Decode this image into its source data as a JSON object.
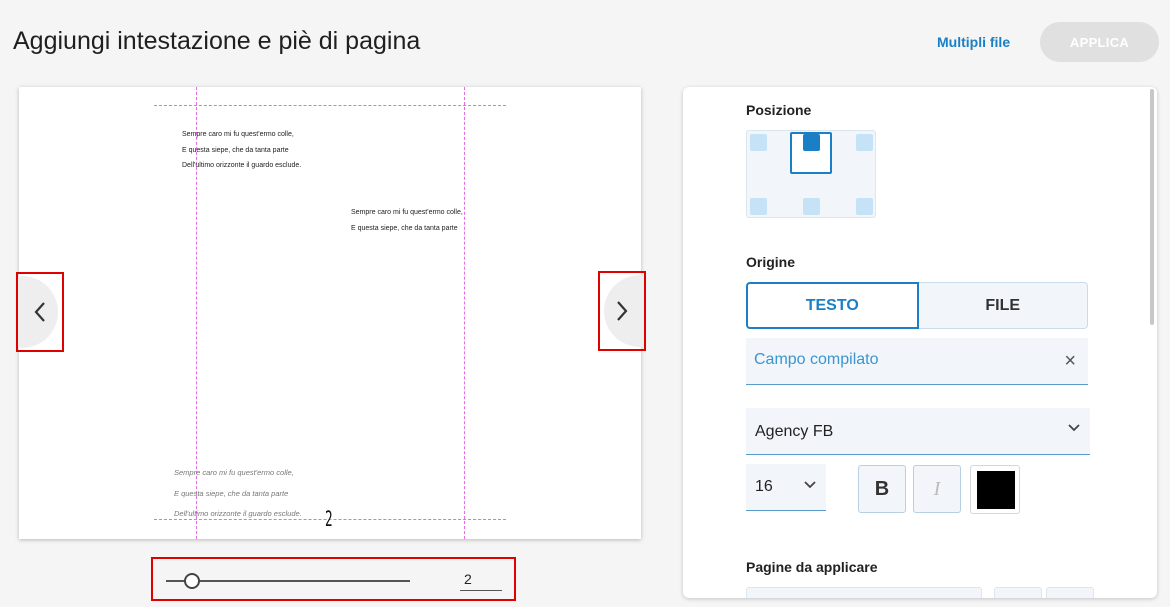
{
  "header": {
    "title": "Aggiungi intestazione e piè di pagina",
    "multi_files_label": "Multipli file",
    "apply_label": "APPLICA"
  },
  "preview": {
    "top_lines": [
      "Sempre caro mi fu quest'ermo colle,",
      "E questa siepe, che da tanta parte",
      "Dell'ultimo orizzonte il guardo esclude."
    ],
    "middle_lines": [
      "Sempre caro mi fu quest'ermo colle,",
      "E questa siepe, che da tanta parte"
    ],
    "footer_lines": [
      "Sempre caro mi fu quest'ermo colle,",
      "E questa siepe, che da tanta parte",
      "Dell'ultimo orizzonte il guardo esclude."
    ],
    "page_number": "2"
  },
  "slider": {
    "value": "2"
  },
  "panel": {
    "position_label": "Posizione",
    "origin_label": "Origine",
    "text_tab": "TESTO",
    "file_tab": "FILE",
    "text_field_placeholder": "Campo compilato",
    "font_value": "Agency FB",
    "size_value": "16",
    "bold_label": "B",
    "italic_label": "I",
    "color": "#000000",
    "pages_label": "Pagine da applicare"
  },
  "icons": {
    "prev": "chevron-left-icon",
    "next": "chevron-right-icon",
    "clear": "close-icon",
    "dropdown": "chevron-down-icon"
  }
}
